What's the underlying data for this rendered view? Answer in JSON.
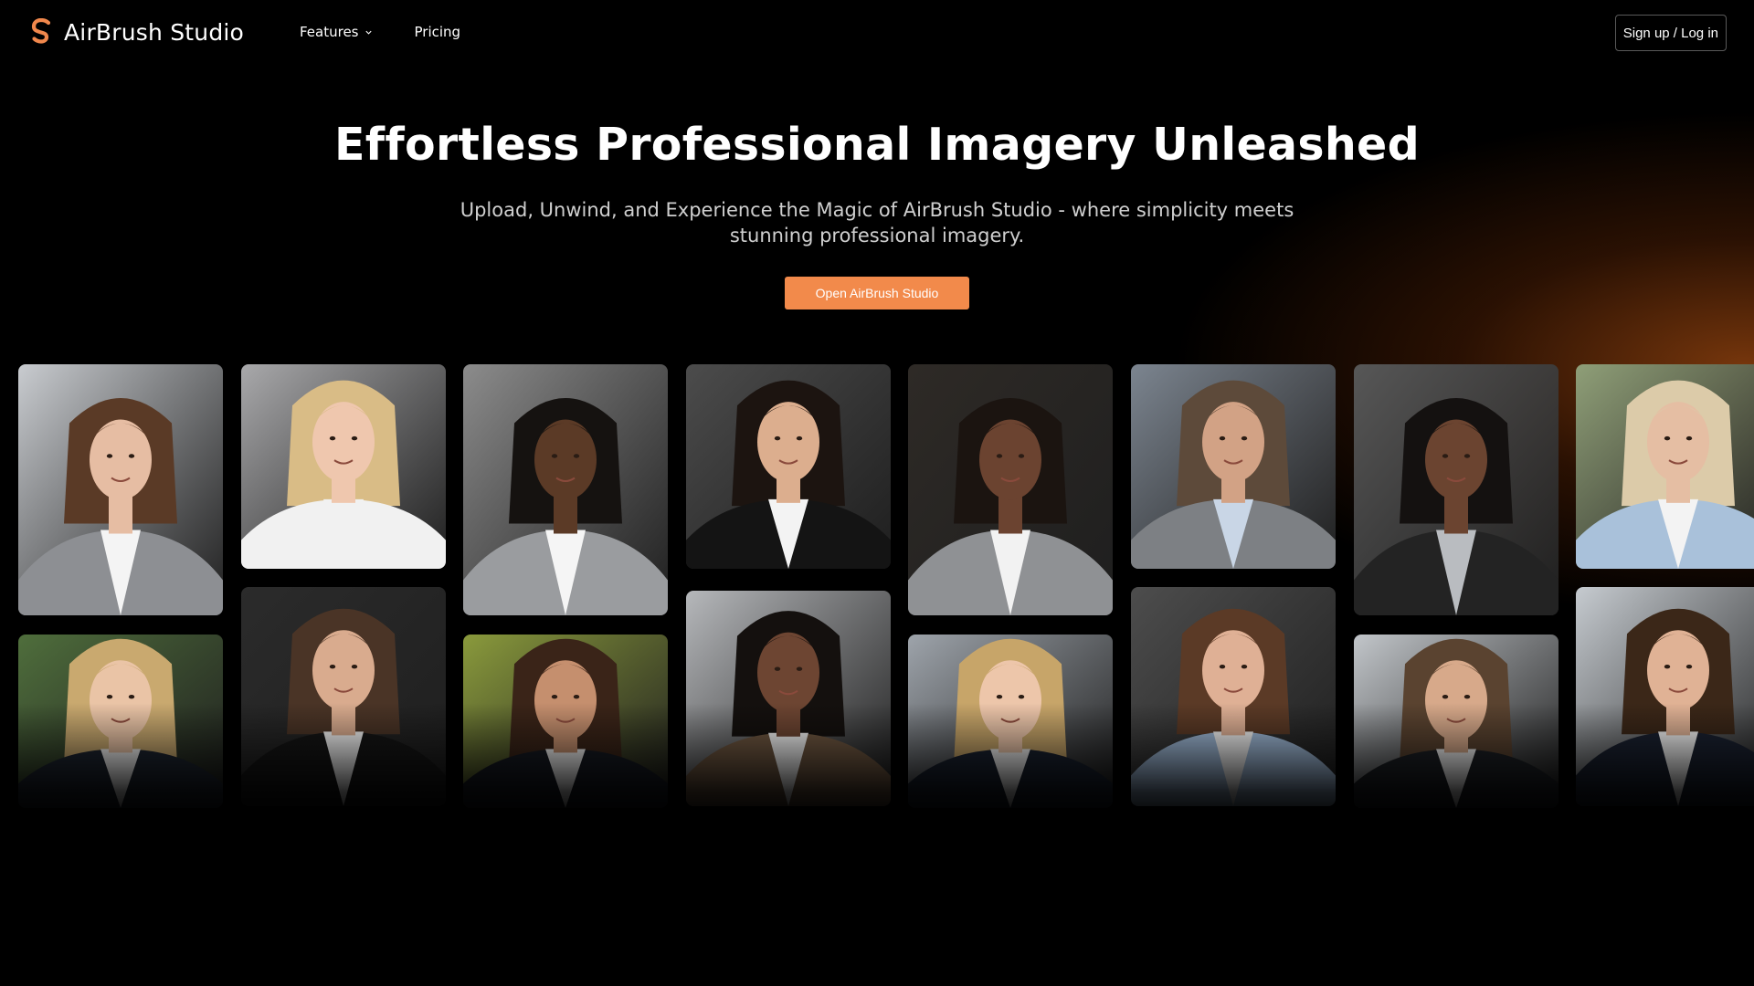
{
  "header": {
    "brand": "AirBrush Studio",
    "logo_icon": "airbrush-s-logo-icon",
    "nav": [
      {
        "label": "Features",
        "has_dropdown": true
      },
      {
        "label": "Pricing",
        "has_dropdown": false
      }
    ],
    "auth_label": "Sign up / Log in"
  },
  "hero": {
    "title": "Effortless Professional Imagery Unleashed",
    "subtitle": "Upload, Unwind, and Experience the Magic of AirBrush Studio - where simplicity meets stunning professional imagery.",
    "cta_label": "Open AirBrush Studio"
  },
  "colors": {
    "background": "#000000",
    "accent": "#f28a4b",
    "glow": "#d66216"
  },
  "gallery": {
    "items": [
      {
        "name": "woman-bob-gray-blazer-office",
        "bg": "#c9ccd0",
        "skin": "#e6bda3",
        "hair": "#5a3a26",
        "suit": "#8d8f93",
        "shirt": "#f4f4f4"
      },
      {
        "name": "blonde-woman-white-shirt",
        "bg": "#a9a9ab",
        "skin": "#efc7ae",
        "hair": "#d9bc86",
        "suit": "#f1f1f1",
        "shirt": "#f1f1f1"
      },
      {
        "name": "man-gray-suit-tie",
        "bg": "#8c8c8c",
        "skin": "#5b3a26",
        "hair": "#151210",
        "suit": "#9a9c9f",
        "shirt": "#f5f5f5"
      },
      {
        "name": "young-man-black-suit",
        "bg": "#4c4c4c",
        "skin": "#dcae8e",
        "hair": "#1c1410",
        "suit": "#141414",
        "shirt": "#f3f3f3"
      },
      {
        "name": "woman-curly-hair-bookshelf",
        "bg": "#2e2a26",
        "skin": "#6b4330",
        "hair": "#1b1410",
        "suit": "#8f9194",
        "shirt": "#f2f2f2"
      },
      {
        "name": "man-gray-suit-window",
        "bg": "#7c8590",
        "skin": "#d2a285",
        "hair": "#5d4a3a",
        "suit": "#7d8084",
        "shirt": "#c9d6e6"
      },
      {
        "name": "man-beard-dark-suit",
        "bg": "#575757",
        "skin": "#6b4430",
        "hair": "#141110",
        "suit": "#232323",
        "shirt": "#b9bcc0"
      },
      {
        "name": "older-woman-light-blue-blazer-park",
        "bg": "#8f9f78",
        "skin": "#e5bea3",
        "hair": "#dccba9",
        "suit": "#a9c1da",
        "shirt": "#f3f3f3"
      },
      {
        "name": "blonde-woman-park",
        "bg": "#4f6e3c",
        "skin": "#eac4a6",
        "hair": "#c9a96f",
        "suit": "#1e2530",
        "shirt": "#f2f2f2"
      },
      {
        "name": "man-black-suit-dark",
        "bg": "#2b2b2b",
        "skin": "#d9ab8e",
        "hair": "#4a3426",
        "suit": "#151515",
        "shirt": "#f3f3f3"
      },
      {
        "name": "woman-long-hair-park-sunny",
        "bg": "#8a9a3c",
        "skin": "#c58f6e",
        "hair": "#3a2418",
        "suit": "#161a22",
        "shirt": "#f2f2f2"
      },
      {
        "name": "woman-brown-blazer-office",
        "bg": "#b6b8bb",
        "skin": "#6d4532",
        "hair": "#14100e",
        "suit": "#6e5640",
        "shirt": "#f3f3f3"
      },
      {
        "name": "blonde-woman-navy-blazer",
        "bg": "#9ea4ab",
        "skin": "#edc6aa",
        "hair": "#c7a569",
        "suit": "#1a2230",
        "shirt": "#f2f2f2"
      },
      {
        "name": "woman-wavy-hair-blue-blazer",
        "bg": "#4d4d4d",
        "skin": "#dfb095",
        "hair": "#5b3a26",
        "suit": "#9eb8d6",
        "shirt": "#f2f2f2"
      },
      {
        "name": "man-styled-hair-city",
        "bg": "#c2c6ca",
        "skin": "#d7a98a",
        "hair": "#5a4330",
        "suit": "#1d2025",
        "shirt": "#f2f2f2"
      },
      {
        "name": "young-man-navy-blazer-office",
        "bg": "#c6cbd0",
        "skin": "#e0b295",
        "hair": "#3b2718",
        "suit": "#1a2130",
        "shirt": "#f3f3f3"
      }
    ]
  }
}
